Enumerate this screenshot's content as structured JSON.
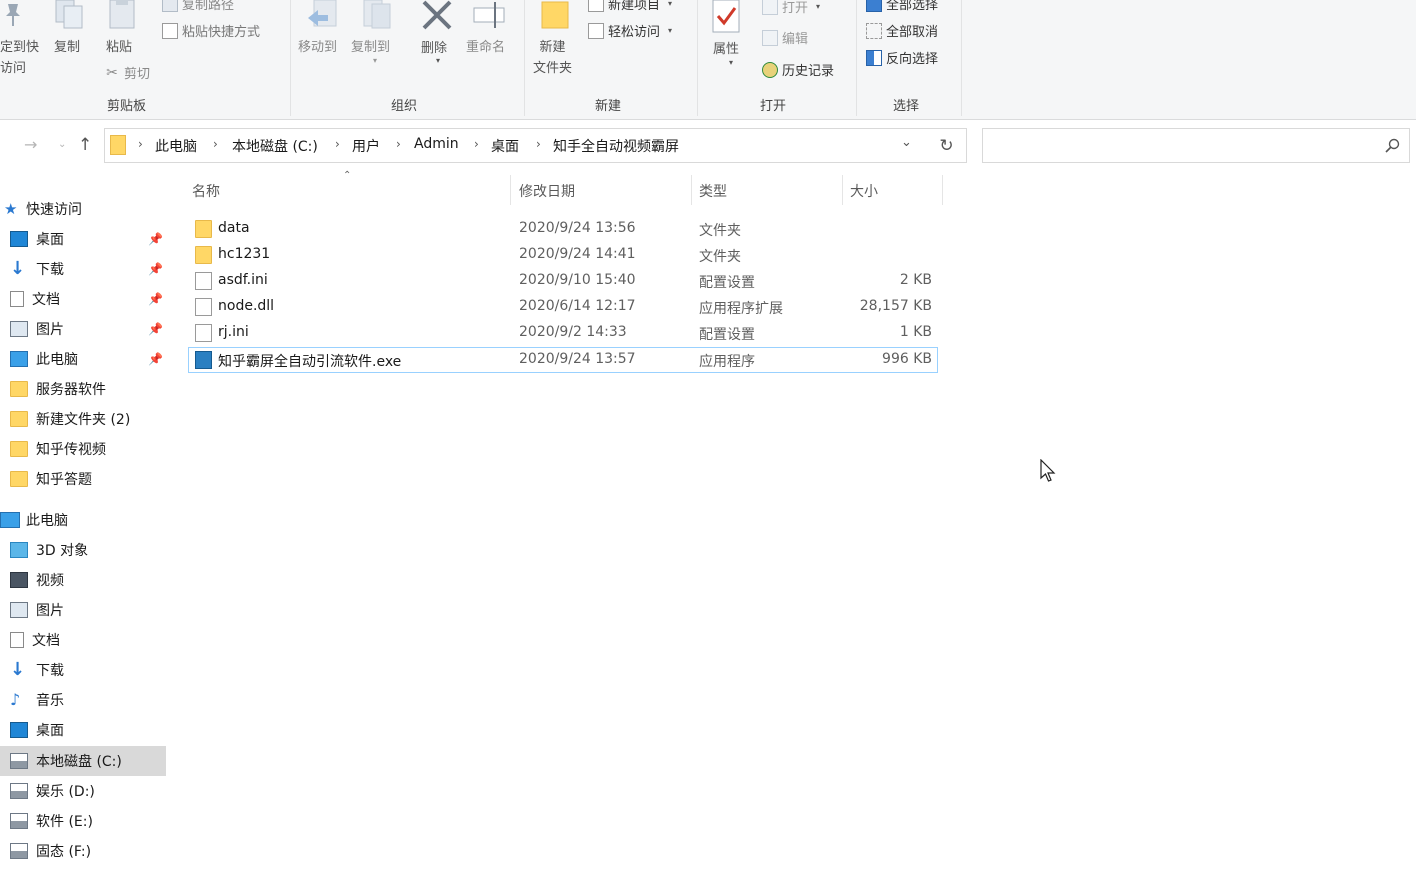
{
  "ribbon": {
    "clipboard": {
      "pin_quick_access": [
        "定到快",
        "访问"
      ],
      "copy": "复制",
      "paste": "粘贴",
      "copy_path": "复制路径",
      "paste_shortcut": "粘贴快捷方式",
      "cut": "剪切",
      "group_label": "剪贴板"
    },
    "organize": {
      "move_to": "移动到",
      "copy_to": "复制到",
      "delete": "删除",
      "rename": "重命名",
      "group_label": "组织"
    },
    "new": {
      "new_folder": [
        "新建",
        "文件夹"
      ],
      "new_item": "新建项目",
      "easy_access": "轻松访问",
      "group_label": "新建"
    },
    "open": {
      "properties": "属性",
      "open": "打开",
      "edit": "编辑",
      "history": "历史记录",
      "group_label": "打开"
    },
    "select": {
      "select_all": "全部选择",
      "select_none": "全部取消",
      "invert": "反向选择",
      "group_label": "选择"
    }
  },
  "breadcrumbs": [
    "此电脑",
    "本地磁盘 (C:)",
    "用户",
    "Admin",
    "桌面",
    "知手全自动视频霸屏"
  ],
  "columns": {
    "name": "名称",
    "date": "修改日期",
    "type": "类型",
    "size": "大小"
  },
  "files": [
    {
      "name": "data",
      "date": "2020/9/24 13:56",
      "type": "文件夹",
      "size": "",
      "icon": "folder-icon"
    },
    {
      "name": "hc1231",
      "date": "2020/9/24 14:41",
      "type": "文件夹",
      "size": "",
      "icon": "folder-icon"
    },
    {
      "name": "asdf.ini",
      "date": "2020/9/10 15:40",
      "type": "配置设置",
      "size": "2 KB",
      "icon": "settings-file-icon"
    },
    {
      "name": "node.dll",
      "date": "2020/6/14 12:17",
      "type": "应用程序扩展",
      "size": "28,157 KB",
      "icon": "dll-file-icon"
    },
    {
      "name": "rj.ini",
      "date": "2020/9/2 14:33",
      "type": "配置设置",
      "size": "1 KB",
      "icon": "settings-file-icon"
    },
    {
      "name": "知乎霸屏全自动引流软件.exe",
      "date": "2020/9/24 13:57",
      "type": "应用程序",
      "size": "996 KB",
      "icon": "app-icon"
    }
  ],
  "nav": {
    "quick_access": "快速访问",
    "quick_items": [
      "桌面",
      "下载",
      "文档",
      "图片",
      "此电脑",
      "服务器软件",
      "新建文件夹 (2)",
      "知乎传视频",
      "知乎答题"
    ],
    "this_pc": "此电脑",
    "pc_items": [
      "3D 对象",
      "视频",
      "图片",
      "文档",
      "下载",
      "音乐",
      "桌面",
      "本地磁盘 (C:)",
      "娱乐 (D:)",
      "软件 (E:)",
      "固态 (F:)"
    ]
  }
}
